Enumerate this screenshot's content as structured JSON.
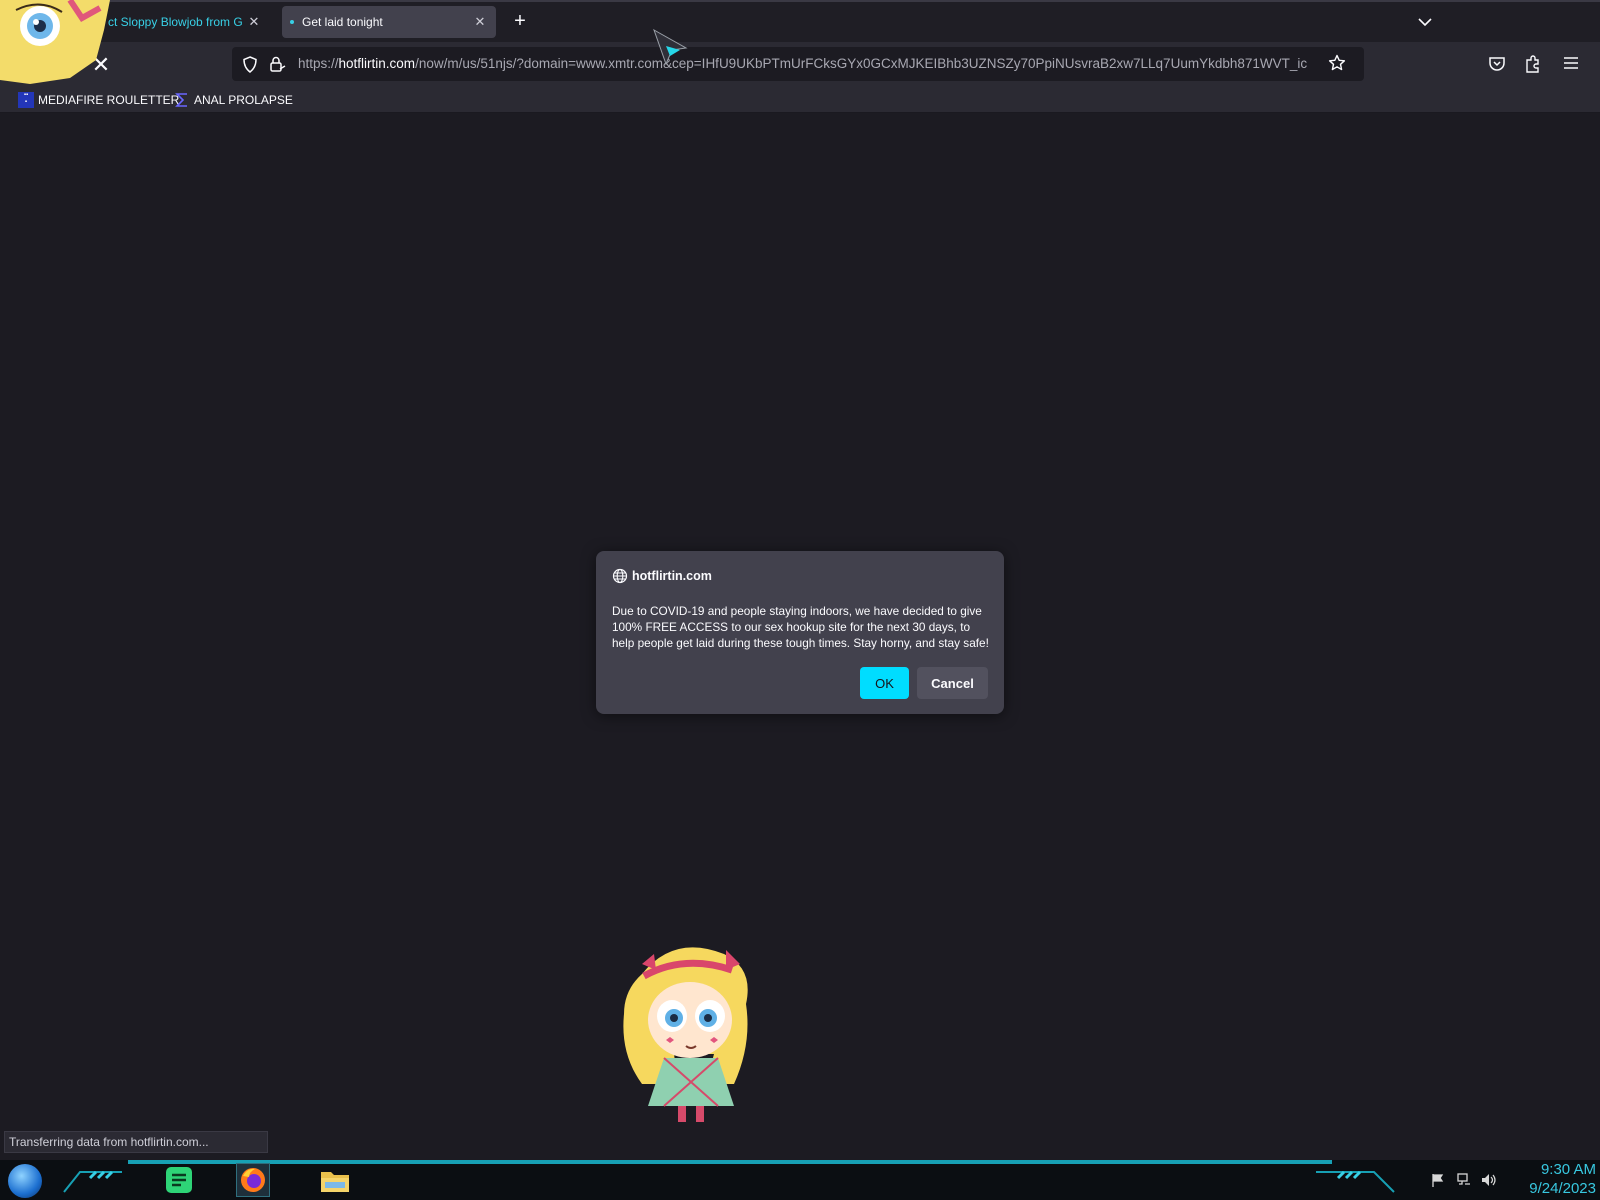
{
  "browser": {
    "tabs": [
      {
        "title": "ct Sloppy Blowjob from G",
        "active": false
      },
      {
        "title": "Get laid tonight",
        "active": true
      }
    ],
    "url": {
      "prefix": "https://",
      "domain": "hotflirtin.com",
      "rest": "/now/m/us/51njs/?domain=www.xmtr.com&cep=IHfU9UKbPTmUrFCksGYx0GCxMJKEIBhb3UZNSZy70PpiNUsvraB2xw7LLq7UumYkdbh871WVT_ic"
    },
    "bookmarks": [
      {
        "label": "MEDIAFIRE ROULETTER",
        "icon": "hf-icon"
      },
      {
        "label": "ANAL PROLAPSE",
        "icon": "sigma-icon"
      }
    ],
    "status_text": "Transferring data from hotflirtin.com..."
  },
  "dialog": {
    "origin": "hotflirtin.com",
    "message": "Due to COVID-19 and people staying indoors, we have decided to give 100% FREE ACCESS to our sex hookup site for the next 30 days, to help people get laid during these tough times. Stay horny, and stay safe!",
    "ok_label": "OK",
    "cancel_label": "Cancel"
  },
  "taskbar": {
    "time": "9:30 AM",
    "date": "9/24/2023",
    "apps": [
      "notes-app-icon",
      "firefox-icon",
      "file-explorer-icon"
    ]
  },
  "colors": {
    "accent": "#00ddff",
    "tab_accent": "#38d0e6",
    "page_bg": "#1c1b22",
    "clock": "#38c8e0"
  }
}
